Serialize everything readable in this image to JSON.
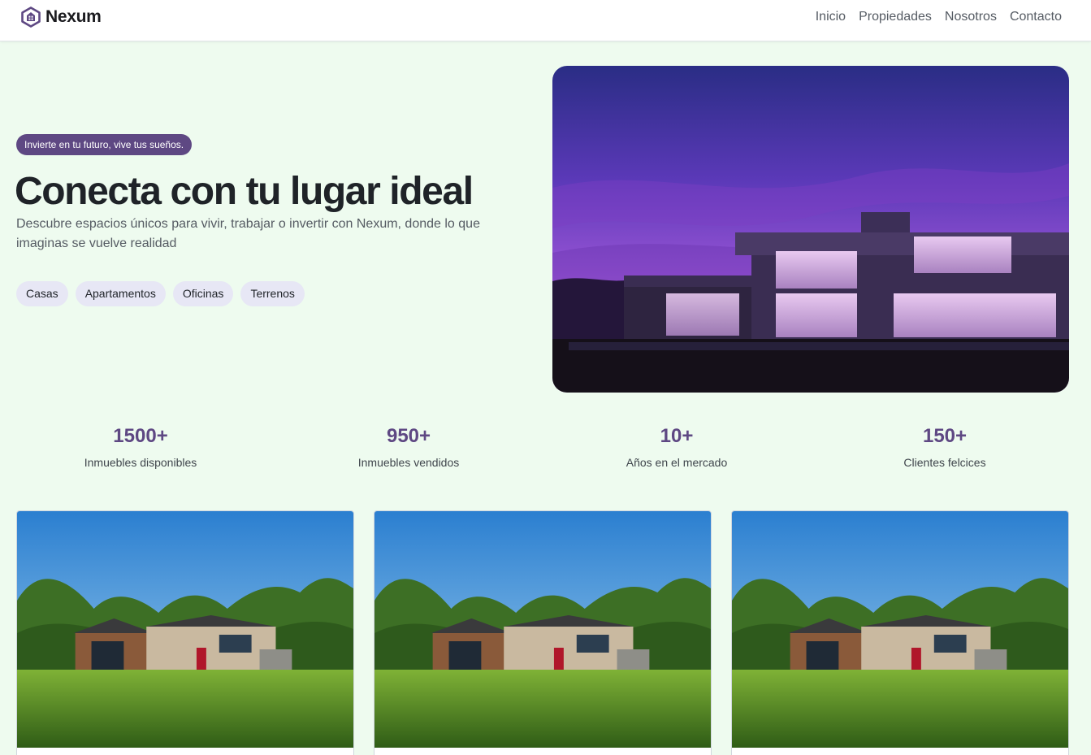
{
  "brand": {
    "name": "Nexum",
    "logo_icon": "house-hexagon-icon",
    "accent": "#5e4883"
  },
  "nav": {
    "items": [
      "Inicio",
      "Propiedades",
      "Nosotros",
      "Contacto"
    ]
  },
  "hero": {
    "badge": "Invierte en tu futuro, vive tus sueños.",
    "title": "Conecta con tu lugar ideal",
    "description": "Descubre espacios únicos para vivir, trabajar o invertir con Nexum, donde lo que imaginas se vuelve realidad",
    "categories": [
      "Casas",
      "Apartamentos",
      "Oficinas",
      "Terrenos"
    ]
  },
  "stats": [
    {
      "value": "1500+",
      "label": "Inmuebles disponibles"
    },
    {
      "value": "950+",
      "label": "Inmuebles vendidos"
    },
    {
      "value": "10+",
      "label": "Años en el mercado"
    },
    {
      "value": "150+",
      "label": "Clientes felcices"
    }
  ],
  "colors": {
    "background": "#eefbef",
    "accent": "#5e4883",
    "chip": "#e7e7f5"
  }
}
